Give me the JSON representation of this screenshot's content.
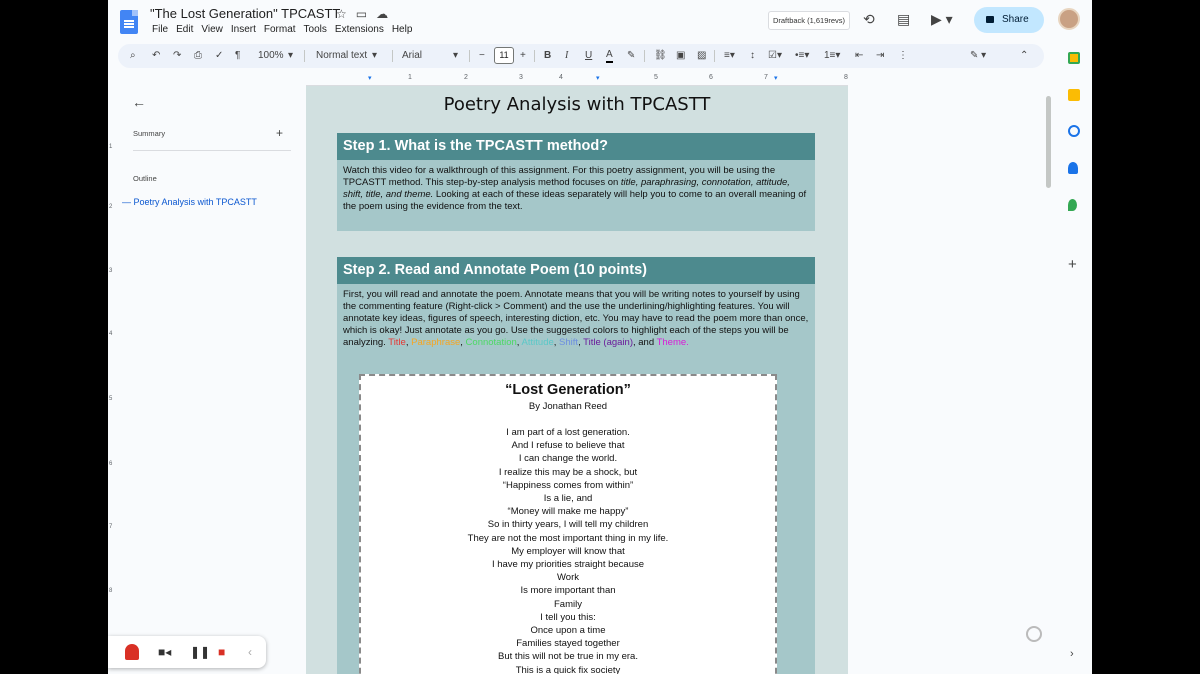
{
  "document": {
    "title": "\"The Lost Generation\" TPCASTT",
    "draftback_label": "Draftback (1,619revs)",
    "share_label": "Share"
  },
  "menu": [
    "File",
    "Edit",
    "View",
    "Insert",
    "Format",
    "Tools",
    "Extensions",
    "Help"
  ],
  "toolbar": {
    "zoom": "100%",
    "style": "Normal text",
    "font": "Arial",
    "font_size": "11",
    "bold": "B",
    "italic": "I",
    "underline_color": "A"
  },
  "ruler_marks": [
    "1",
    "2",
    "3",
    "4",
    "5",
    "6",
    "7",
    "8"
  ],
  "vruler_marks": [
    "1",
    "2",
    "3",
    "4",
    "5",
    "6",
    "7",
    "8"
  ],
  "sidebar": {
    "summary_label": "Summary",
    "outline_label": "Outline",
    "outline_items": [
      "Poetry Analysis with TPCASTT"
    ]
  },
  "content": {
    "title": "Poetry Analysis with TPCASTT",
    "step1": {
      "heading": "Step 1. What is the TPCASTT method?",
      "text_a": "Watch this video for a walkthrough of this assignment. For this poetry assignment, you will be using the TPCASTT method. This step-by-step analysis method focuses on ",
      "text_em": "title, paraphrasing, connotation, attitude, shift, title, and theme.",
      "text_b": " Looking at each of these ideas separately will help you to come to an overall meaning of the poem using the evidence from the text."
    },
    "step2": {
      "heading": "Step 2. Read and Annotate Poem (10 points)",
      "text": "First, you will read and annotate the poem. Annotate means that you will be writing notes to yourself by using the commenting feature (Right-click > Comment) and the use the underlining/highlighting features. You will annotate key ideas, figures of speech, interesting diction, etc. You may have to read the poem more than once, which is okay! Just annotate as you go. Use the suggested colors to highlight each of the steps you will be analyzing. ",
      "colors": [
        {
          "label": "Title",
          "color": "#e53935"
        },
        {
          "label": "Paraphrase",
          "color": "#f5a623"
        },
        {
          "label": "Connotation",
          "color": "#4cd964"
        },
        {
          "label": "Attitude",
          "color": "#5ac8c8"
        },
        {
          "label": "Shift",
          "color": "#6d8fe0"
        },
        {
          "label": "Title (again)",
          "color": "#6a1b9a"
        },
        {
          "label": "Theme.",
          "color": "#d81bd8"
        }
      ],
      "and_word": "and"
    },
    "poem": {
      "title": "“Lost Generation”",
      "author": "By Jonathan Reed",
      "lines": [
        "I am part of a lost generation.",
        "And I refuse to believe that",
        "I can change the world.",
        "I realize this may be a shock, but",
        "“Happiness comes from within”",
        "Is a lie, and",
        "“Money will make me happy”",
        "So in thirty years, I will tell my children",
        "They are not the most important thing in my life.",
        "My employer will know that",
        "I have my priorities straight because",
        "Work",
        "Is more important than",
        "Family",
        "I tell you this:",
        "Once upon a time",
        "Families stayed together",
        "But this will not be true in my era.",
        "This is a quick fix society"
      ]
    }
  },
  "colors": {
    "page_bg": "#d1e0e0",
    "heading_bg": "#4d8a8e",
    "body_bg": "#a5c7c9",
    "accent": "#0b57d0"
  }
}
